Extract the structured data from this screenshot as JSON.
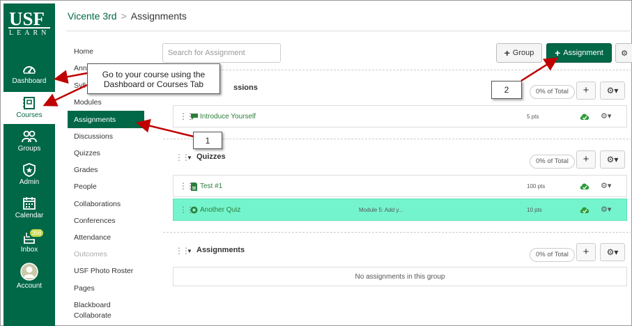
{
  "global_nav": {
    "logo": {
      "top": "USF",
      "bottom": "LEARN"
    },
    "items": [
      {
        "label": "Dashboard",
        "icon": "dashboard-icon"
      },
      {
        "label": "Courses",
        "icon": "courses-icon",
        "active": true
      },
      {
        "label": "Groups",
        "icon": "groups-icon"
      },
      {
        "label": "Admin",
        "icon": "admin-icon"
      },
      {
        "label": "Calendar",
        "icon": "calendar-icon"
      },
      {
        "label": "Inbox",
        "icon": "inbox-icon",
        "badge": "356"
      },
      {
        "label": "Account",
        "icon": "avatar-icon"
      }
    ]
  },
  "breadcrumb": {
    "course": "Vicente 3rd",
    "separator": ">",
    "page": "Assignments"
  },
  "course_nav": {
    "items": [
      "Home",
      "Ann",
      "Syll",
      "Modules",
      "Assignments",
      "Discussions",
      "Quizzes",
      "Grades",
      "People",
      "Collaborations",
      "Conferences",
      "Attendance",
      "Outcomes",
      "USF Photo Roster",
      "Pages",
      "Blackboard",
      "Collaborate"
    ],
    "active": "Assignments"
  },
  "toolbar": {
    "search_placeholder": "Search for Assignment",
    "group_button": "Group",
    "assignment_button": "Assignment",
    "plus": "+"
  },
  "groups": [
    {
      "name": "ssions",
      "percent": "0% of Total",
      "items": [
        {
          "title": "Introduce Yourself",
          "points": "5 pts",
          "icon": "discussion-icon"
        }
      ]
    },
    {
      "name": "Quizzes",
      "percent": "0% of Total",
      "items": [
        {
          "title": "Test #1",
          "points": "100 pts",
          "icon": "assignment-icon"
        },
        {
          "title": "Another Quiz",
          "module": "Module 5: Add y...",
          "points": "10 pts",
          "icon": "quiz-icon",
          "highlighted": true
        }
      ]
    },
    {
      "name": "Assignments",
      "percent": "0% of Total",
      "empty_text": "No assignments in this group"
    }
  ],
  "callouts": {
    "main": "Go to your course using the Dashboard or Courses Tab",
    "step1": "1",
    "step2": "2"
  },
  "colors": {
    "brand_green": "#006747",
    "highlight": "#74f4cc",
    "annotation_arrow": "#c00000",
    "link_green": "#2d7e3a"
  }
}
